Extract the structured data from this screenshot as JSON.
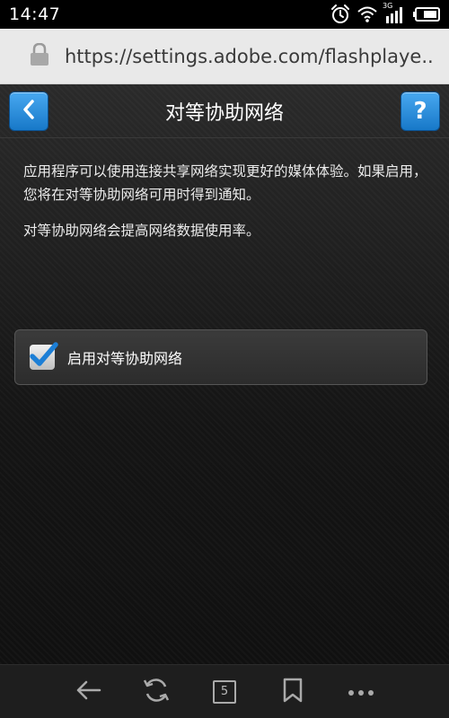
{
  "status_bar": {
    "time": "14:47",
    "network_label": "3G",
    "icons": [
      "alarm-icon",
      "wifi-icon",
      "signal-icon",
      "battery-icon"
    ]
  },
  "browser": {
    "url": "https://settings.adobe.com/flashplaye..",
    "tab_count": "5",
    "nav_icons": [
      "back-arrow-icon",
      "refresh-icon",
      "tabs-icon",
      "bookmark-icon",
      "more-icon"
    ]
  },
  "panel": {
    "title": "对等协助网络",
    "back_icon": "chevron-left-icon",
    "help_label": "?",
    "description_1": "应用程序可以使用连接共享网络实现更好的媒体体验。如果启用，您将在对等协助网络可用时得到通知。",
    "description_2": "对等协助网络会提高网络数据使用率。",
    "checkbox_label": "启用对等协助网络",
    "checkbox_checked": true
  },
  "colors": {
    "accent_blue": "#2a8fe0",
    "panel_bg": "#1c1c1c",
    "url_bar_bg": "#e9e9e9"
  }
}
